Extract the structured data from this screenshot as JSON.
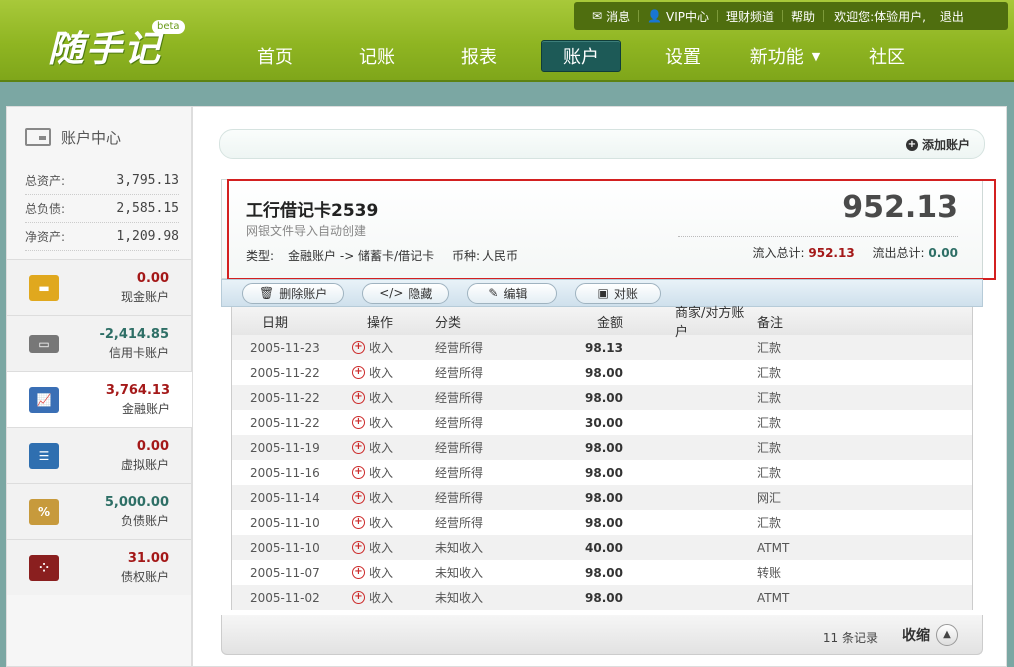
{
  "app": {
    "logo": "随手记",
    "badge": "beta"
  },
  "topbar": {
    "messages": "消息",
    "vip": "VIP中心",
    "finance": "理财频道",
    "help": "帮助",
    "welcome": "欢迎您:体验用户,",
    "logout": "退出"
  },
  "nav": {
    "home": "首页",
    "record": "记账",
    "report": "报表",
    "account": "账户",
    "settings": "设置",
    "features": "新功能",
    "features_arrow": "▼",
    "community": "社区"
  },
  "sidebar": {
    "title": "账户中心",
    "totals": [
      {
        "label": "总资产:",
        "value": "3,795.13"
      },
      {
        "label": "总负债:",
        "value": "2,585.15"
      },
      {
        "label": "净资产:",
        "value": "1,209.98"
      }
    ],
    "accounts": [
      {
        "amount": "0.00",
        "label": "现金账户",
        "icon": "gold-bars-icon"
      },
      {
        "amount": "-2,414.85",
        "label": "信用卡账户",
        "icon": "credit-card-icon"
      },
      {
        "amount": "3,764.13",
        "label": "金融账户",
        "icon": "stock-chart-icon"
      },
      {
        "amount": "0.00",
        "label": "虚拟账户",
        "icon": "virtual-card-icon"
      },
      {
        "amount": "5,000.00",
        "label": "负债账户",
        "icon": "money-bag-icon"
      },
      {
        "amount": "31.00",
        "label": "债权账户",
        "icon": "abacus-icon"
      }
    ]
  },
  "main": {
    "add_account": "添加账户",
    "card": {
      "name": "工行借记卡2539",
      "subtitle": "网银文件导入自动创建",
      "type_label": "类型:",
      "type_value": "金融账户 -> 储蓄卡/借记卡",
      "currency_label": "币种:",
      "currency_value": "人民币",
      "balance": "952.13",
      "inflow_label": "流入总计:",
      "inflow_value": "952.13",
      "outflow_label": "流出总计:",
      "outflow_value": "0.00"
    },
    "actions": {
      "delete": "删除账户",
      "hide": "隐藏",
      "edit": "编辑",
      "reconcile": "对账"
    },
    "table": {
      "headers": [
        "日期",
        "操作",
        "分类",
        "金额",
        "商家/对方账户",
        "备注"
      ],
      "rows": [
        {
          "date": "2005-11-23",
          "op": "收入",
          "category": "经营所得",
          "amount": "98.13",
          "merchant": "",
          "note": "汇款"
        },
        {
          "date": "2005-11-22",
          "op": "收入",
          "category": "经营所得",
          "amount": "98.00",
          "merchant": "",
          "note": "汇款"
        },
        {
          "date": "2005-11-22",
          "op": "收入",
          "category": "经营所得",
          "amount": "98.00",
          "merchant": "",
          "note": "汇款"
        },
        {
          "date": "2005-11-22",
          "op": "收入",
          "category": "经营所得",
          "amount": "30.00",
          "merchant": "",
          "note": "汇款"
        },
        {
          "date": "2005-11-19",
          "op": "收入",
          "category": "经营所得",
          "amount": "98.00",
          "merchant": "",
          "note": "汇款"
        },
        {
          "date": "2005-11-16",
          "op": "收入",
          "category": "经营所得",
          "amount": "98.00",
          "merchant": "",
          "note": "汇款"
        },
        {
          "date": "2005-11-14",
          "op": "收入",
          "category": "经营所得",
          "amount": "98.00",
          "merchant": "",
          "note": "网汇"
        },
        {
          "date": "2005-11-10",
          "op": "收入",
          "category": "经营所得",
          "amount": "98.00",
          "merchant": "",
          "note": "汇款"
        },
        {
          "date": "2005-11-10",
          "op": "收入",
          "category": "未知收入",
          "amount": "40.00",
          "merchant": "",
          "note": "ATMT"
        },
        {
          "date": "2005-11-07",
          "op": "收入",
          "category": "未知收入",
          "amount": "98.00",
          "merchant": "",
          "note": "转账"
        },
        {
          "date": "2005-11-02",
          "op": "收入",
          "category": "未知收入",
          "amount": "98.00",
          "merchant": "",
          "note": "ATMT"
        }
      ]
    },
    "footer": {
      "count": "11 条记录",
      "collapse": "收缩"
    }
  },
  "colors": {
    "header_green": "#8fb522",
    "active_tab": "#1d5a57",
    "income_red": "#a41818",
    "outflow_green": "#2e6f66",
    "highlight_red": "#d32020"
  }
}
